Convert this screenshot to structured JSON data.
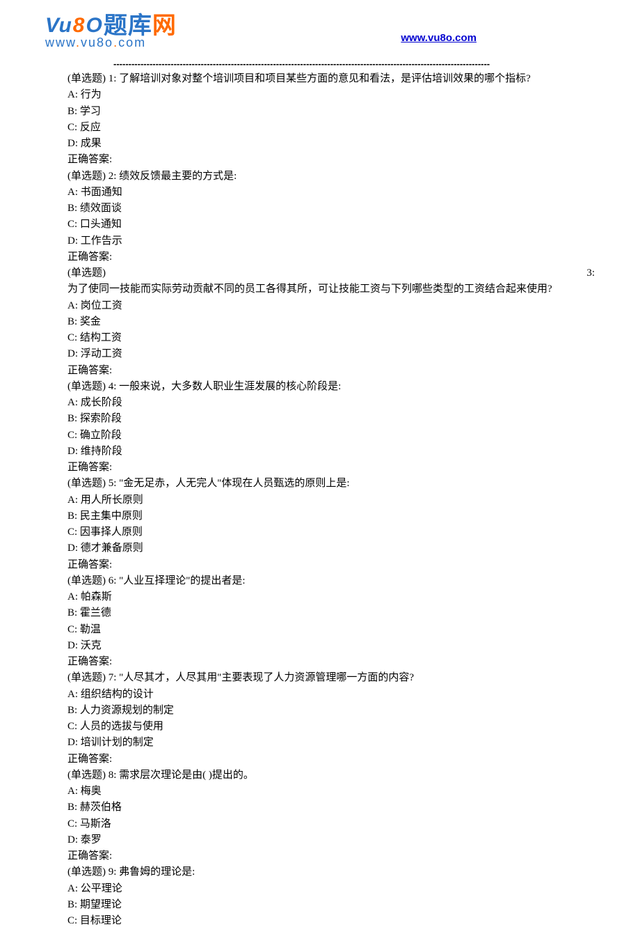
{
  "header": {
    "logo_text_url": "www.vu8o.com",
    "site_link": "www.vu8o.com"
  },
  "questions": [
    {
      "prompt": "(单选题) 1: 了解培训对象对整个培训项目和项目某些方面的意见和看法，是评估培训效果的哪个指标?",
      "options": [
        "A: 行为",
        "B: 学习",
        "C: 反应",
        "D: 成果"
      ],
      "answer_label": "正确答案:"
    },
    {
      "prompt": "(单选题) 2: 绩效反馈最主要的方式是:",
      "options": [
        "A: 书面通知",
        "B: 绩效面谈",
        "C: 口头通知",
        "D: 工作告示"
      ],
      "answer_label": "正确答案:"
    },
    {
      "prompt_prefix": "(单选题)",
      "prompt_suffix": "3:",
      "prompt_line2": "为了使同一技能而实际劳动贡献不同的员工各得其所，可让技能工资与下列哪些类型的工资结合起来使用?",
      "options": [
        "A: 岗位工资",
        "B: 奖金",
        "C: 结构工资",
        "D: 浮动工资"
      ],
      "answer_label": "正确答案:"
    },
    {
      "prompt": "(单选题) 4: 一般来说，大多数人职业生涯发展的核心阶段是:",
      "options": [
        "A: 成长阶段",
        "B: 探索阶段",
        "C: 确立阶段",
        "D: 维持阶段"
      ],
      "answer_label": "正确答案:"
    },
    {
      "prompt": "(单选题) 5: \"金无足赤，人无完人\"体现在人员甄选的原则上是:",
      "options": [
        "A: 用人所长原则",
        "B: 民主集中原则",
        "C: 因事择人原则",
        "D: 德才兼备原则"
      ],
      "answer_label": "正确答案:"
    },
    {
      "prompt": "(单选题) 6: \"人业互择理论\"的提出者是:",
      "options": [
        "A: 帕森斯",
        "B: 霍兰德",
        "C: 勒温",
        "D: 沃克"
      ],
      "answer_label": "正确答案:"
    },
    {
      "prompt": "(单选题) 7: \"人尽其才，人尽其用\"主要表现了人力资源管理哪一方面的内容?",
      "options": [
        "A: 组织结构的设计",
        "B: 人力资源规划的制定",
        "C: 人员的选拔与使用",
        "D: 培训计划的制定"
      ],
      "answer_label": "正确答案:"
    },
    {
      "prompt": "(单选题) 8: 需求层次理论是由( )提出的。",
      "options": [
        "A: 梅奥",
        "B: 赫茨伯格",
        "C: 马斯洛",
        "D: 泰罗"
      ],
      "answer_label": "正确答案:"
    },
    {
      "prompt": "(单选题) 9: 弗鲁姆的理论是:",
      "options": [
        "A: 公平理论",
        "B: 期望理论",
        "C: 目标理论"
      ],
      "answer_label": ""
    }
  ]
}
